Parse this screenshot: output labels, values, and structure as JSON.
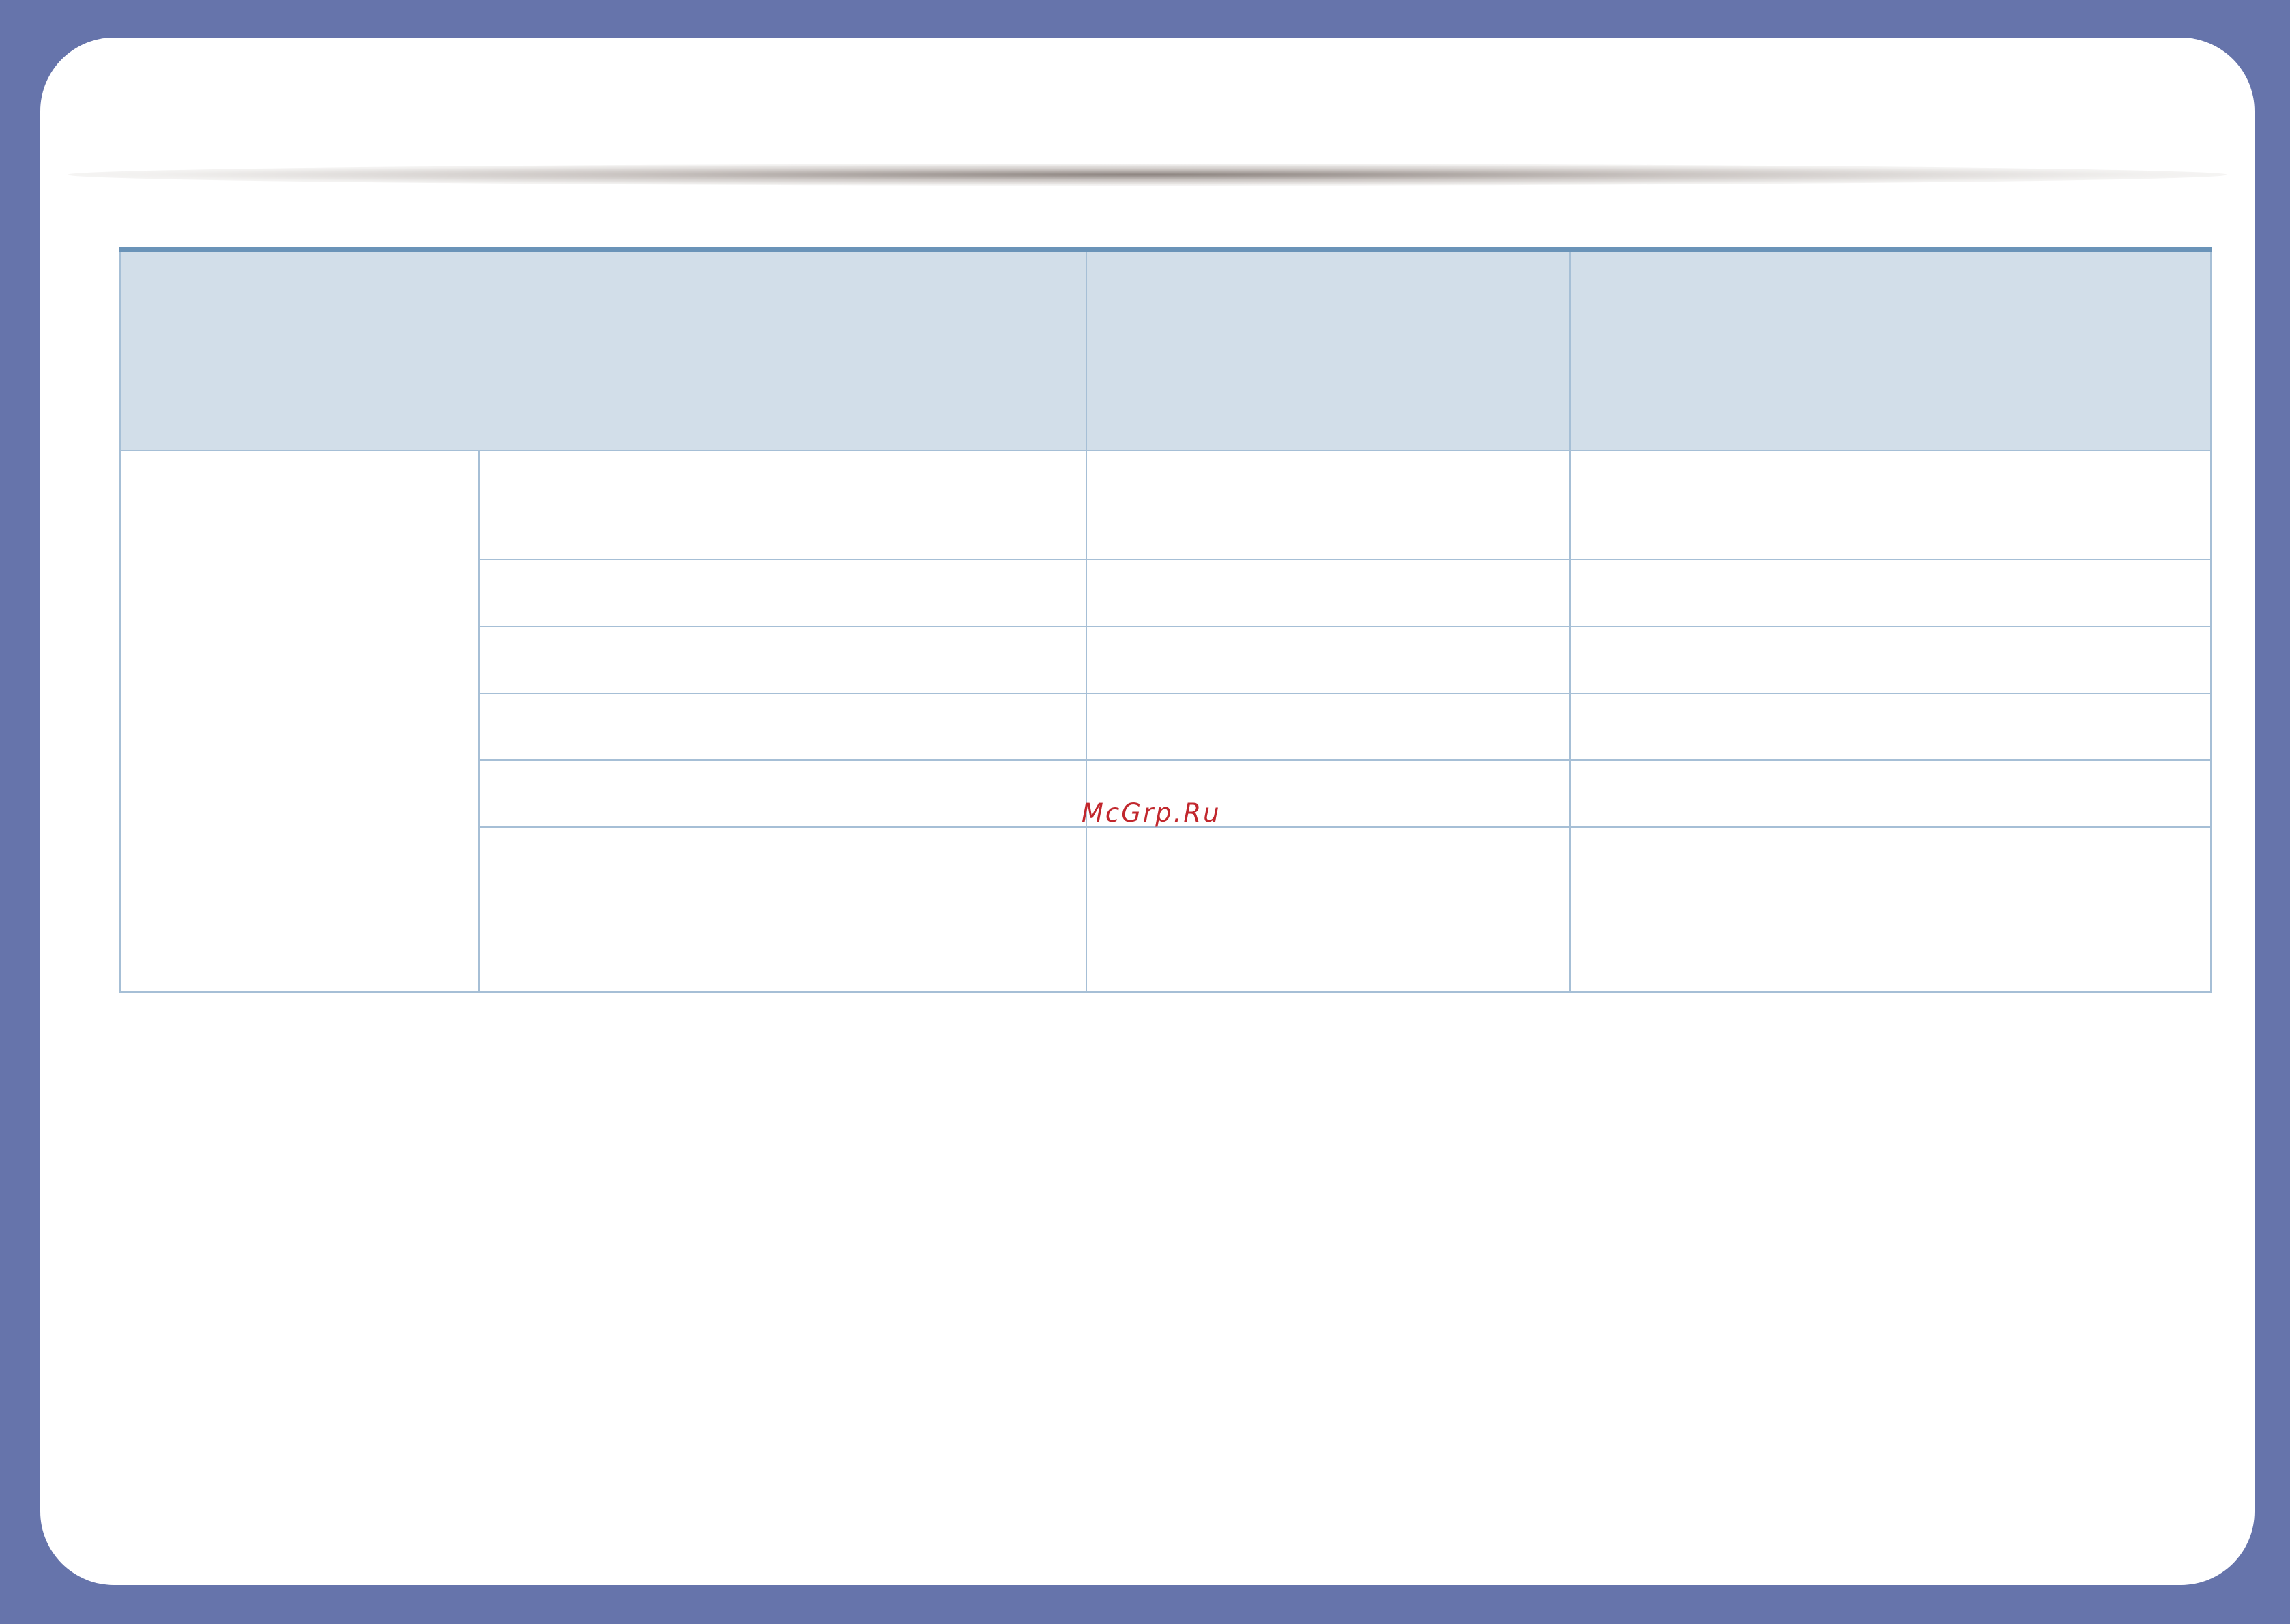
{
  "table": {
    "header": [
      "",
      "",
      ""
    ],
    "group_label": "",
    "rows": [
      [
        "",
        "",
        ""
      ],
      [
        "",
        "",
        ""
      ],
      [
        "",
        "",
        ""
      ],
      [
        "",
        "",
        ""
      ],
      [
        "",
        "",
        ""
      ],
      [
        "",
        "",
        ""
      ]
    ]
  },
  "watermark": "McGrp.Ru",
  "colors": {
    "frame": "#6674ab",
    "table_header": "#d2dee9",
    "table_top_rule": "#6a93b8",
    "table_border": "#a6bfd6",
    "watermark": "#c1272d"
  }
}
